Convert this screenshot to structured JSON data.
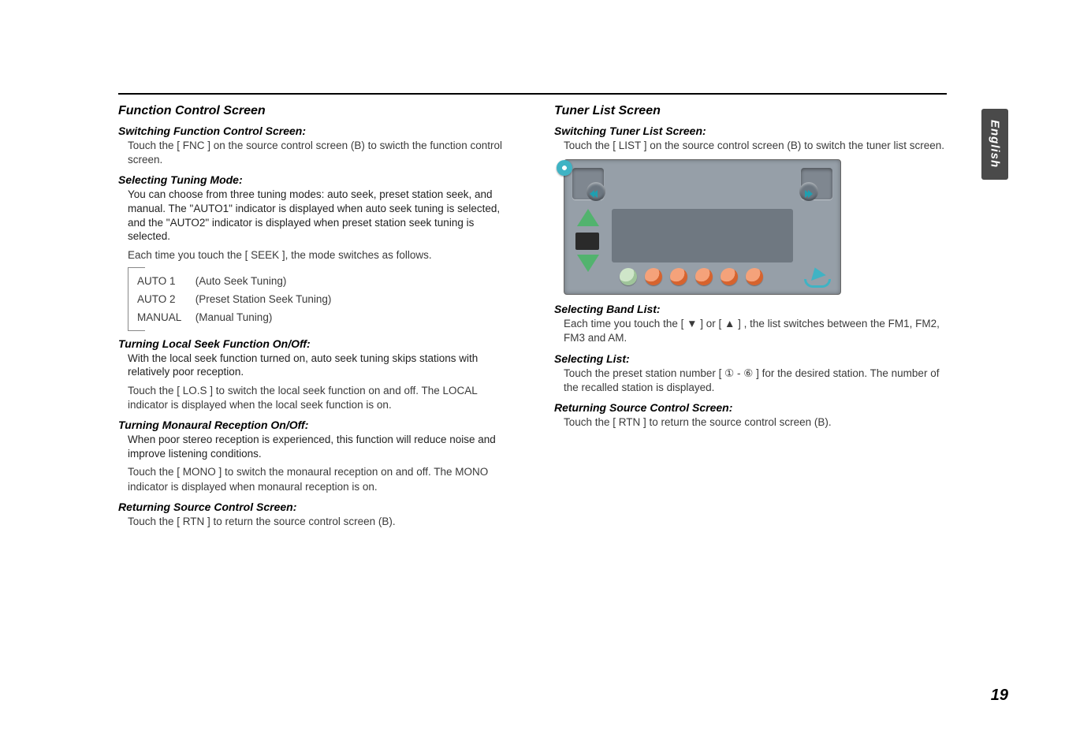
{
  "language_tab": "English",
  "page_number": "19",
  "left": {
    "section_title": "Function Control Screen",
    "sw_heading": "Switching Function Control Screen:",
    "sw_body": "Touch the [ FNC ] on the source control screen (B) to swicth the function control screen.",
    "sel_heading": "Selecting Tuning Mode:",
    "sel_body": "You can choose from three tuning modes: auto seek, preset station seek, and manual. The \"AUTO1\" indicator is displayed when auto seek tuning is selected, and the \"AUTO2\" indicator is displayed when preset station seek tuning is selected.",
    "sel_body2": "Each time you touch the [ SEEK ], the mode switches as follows.",
    "modes": [
      {
        "key": "AUTO 1",
        "desc": "(Auto Seek Tuning)"
      },
      {
        "key": "AUTO 2",
        "desc": "(Preset Station Seek Tuning)"
      },
      {
        "key": "MANUAL",
        "desc": "(Manual Tuning)"
      }
    ],
    "local_heading": "Turning Local Seek Function On/Off:",
    "local_body": "With the local seek function turned on, auto seek tuning skips stations with relatively poor reception.",
    "local_body2": "Touch the [ LO.S ] to switch the local seek function on and off. The LOCAL indicator is displayed when the local seek function is on.",
    "mono_heading": "Turning Monaural Reception On/Off:",
    "mono_body": "When poor stereo reception is experienced, this function will reduce noise and improve listening conditions.",
    "mono_body2": "Touch the [ MONO ] to switch the monaural reception on and off. The MONO indicator is displayed when monaural reception is on.",
    "rtn_heading": "Returning Source Control Screen:",
    "rtn_body": "Touch the  [ RTN  ] to return the source control screen (B)."
  },
  "right": {
    "section_title": "Tuner List Screen",
    "sw_heading": "Switching Tuner List Screen:",
    "sw_body": "Touch the [ LIST ] on the source control screen (B) to switch the tuner list screen.",
    "band_heading": "Selecting Band List:",
    "band_body": "Each time you touch the  [ ▼ ] or [ ▲ ] , the list switches between the FM1, FM2, FM3 and AM.",
    "list_heading": "Selecting List:",
    "list_body": "Touch the preset station number  [ ① - ⑥ ] for the desired station. The number of the recalled station is displayed.",
    "rtn_heading": "Returning Source Control Screen:",
    "rtn_body": "Touch the [ RTN ] to return the source control screen (B)."
  }
}
